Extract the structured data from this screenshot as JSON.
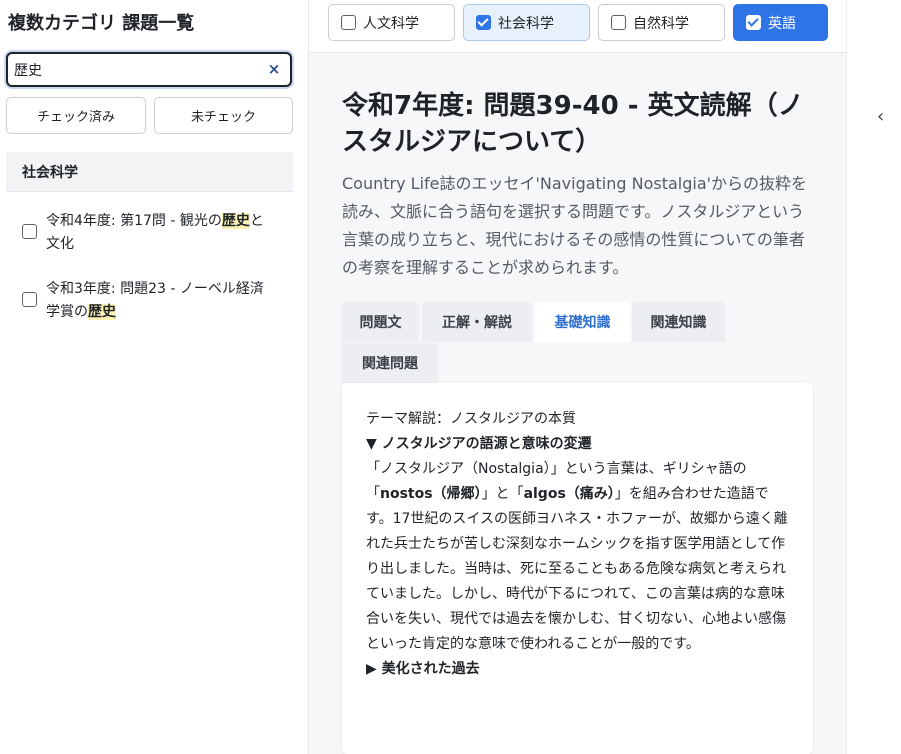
{
  "sidebar": {
    "title": "複数カテゴリ 課題一覧",
    "search": {
      "value": "歴史",
      "placeholder": ""
    },
    "clear_icon": "×",
    "filter_checked_label": "チェック済み",
    "filter_unchecked_label": "未チェック",
    "category_header": "社会科学",
    "items": [
      {
        "prefix": "令和4年度: 第17問 - 観光の",
        "highlight": "歴史",
        "suffix": "と文化",
        "checked": false
      },
      {
        "prefix": "令和3年度: 問題23 - ノーベル経済学賞の",
        "highlight": "歴史",
        "suffix": "",
        "checked": false
      }
    ]
  },
  "category_tabs": [
    {
      "label": "人文科学",
      "checked": false
    },
    {
      "label": "社会科学",
      "checked": true
    },
    {
      "label": "自然科学",
      "checked": false
    },
    {
      "label": "英語",
      "checked": true
    }
  ],
  "question": {
    "title": "令和7年度: 問題39-40 - 英文読解（ノスタルジアについて）",
    "description": "Country Life誌のエッセイ'Navigating Nostalgia'からの抜粋を読み、文脈に合う語句を選択する問題です。ノスタルジアという言葉の成り立ちと、現代におけるその感情の性質についての筆者の考察を理解することが求められます。"
  },
  "tabs": [
    {
      "label": "問題文",
      "active": false
    },
    {
      "label": "正解・解説",
      "active": false
    },
    {
      "label": "基礎知識",
      "active": true
    },
    {
      "label": "関連知識",
      "active": false
    },
    {
      "label": "関連問題",
      "active": false
    }
  ],
  "content": {
    "heading": "テーマ解説：ノスタルジアの本質",
    "section1_title": "▼ ノスタルジアの語源と意味の変遷",
    "section1_p1": "「ノスタルジア（Nostalgia）」という言葉は、ギリシャ語の「",
    "section1_term1": "nostos（帰郷）",
    "section1_p2": "」と「",
    "section1_term2": "algos（痛み）",
    "section1_p3": "」を組み合わせた造語です。17世紀のスイスの医師ヨハネス・ホファーが、故郷から遠く離れた兵士たちが苦しむ深刻なホームシックを指す医学用語として作り出しました。当時は、死に至ることもある危険な病気と考えられていました。しかし、時代が下るにつれて、この言葉は病的な意味合いを失い、現代では過去を懐かしむ、甘く切ない、心地よい感傷といった肯定的な意味で使われることが一般的です。",
    "section2_title": "▶ 美化された過去"
  },
  "rail": {
    "collapse_icon": "‹"
  },
  "colors": {
    "accent": "#2f74e6",
    "active_tab_text": "#2f6fcf",
    "highlight": "#fdf2b5"
  }
}
